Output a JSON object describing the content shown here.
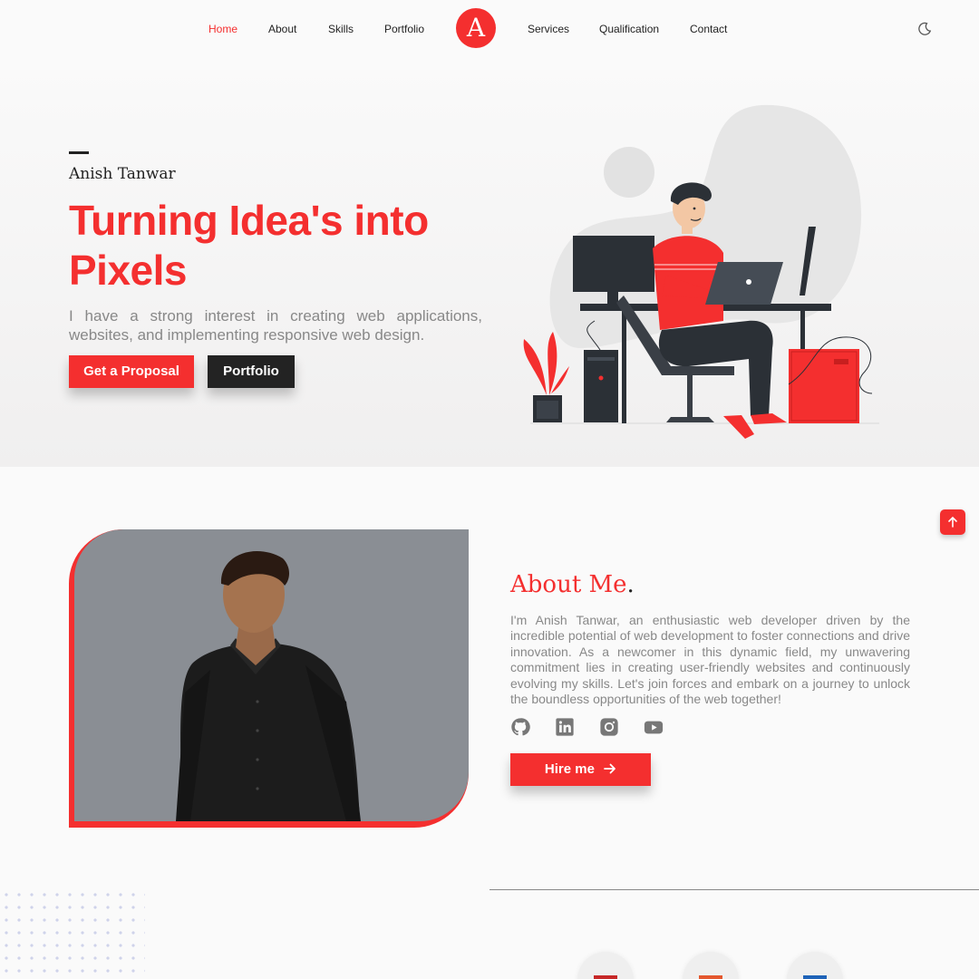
{
  "nav": {
    "left_items": [
      "Home",
      "About",
      "Skills",
      "Portfolio"
    ],
    "right_items": [
      "Services",
      "Qualification",
      "Contact"
    ],
    "active": "Home",
    "logo_letter": "A",
    "theme_toggle_icon": "moon-icon"
  },
  "hero": {
    "name": "Anish Tanwar",
    "title": "Turning Idea's into Pixels",
    "description": "I have a strong interest in creating web applications, websites, and implementing responsive web design.",
    "primary_button": "Get a Proposal",
    "secondary_button": "Portfolio"
  },
  "about": {
    "title": "About Me",
    "title_dot": ".",
    "description": "I'm Anish Tanwar, an enthusiastic web developer driven by the incredible potential of web development to foster connections and drive innovation. As a newcomer in this dynamic field, my unwavering commitment lies in creating user-friendly websites and continuously evolving my skills. Let's join forces and embark on a journey to unlock the boundless opportunities of the web together!",
    "socials": [
      "github-icon",
      "linkedin-icon",
      "instagram-icon",
      "youtube-icon"
    ],
    "hire_button": "Hire me",
    "hire_icon": "arrow-right-icon"
  },
  "scroll_top_icon": "arrow-up-icon",
  "colors": {
    "accent": "#f42f2f",
    "dark": "#232323",
    "muted_text": "#888888",
    "background": "#fafafa"
  }
}
